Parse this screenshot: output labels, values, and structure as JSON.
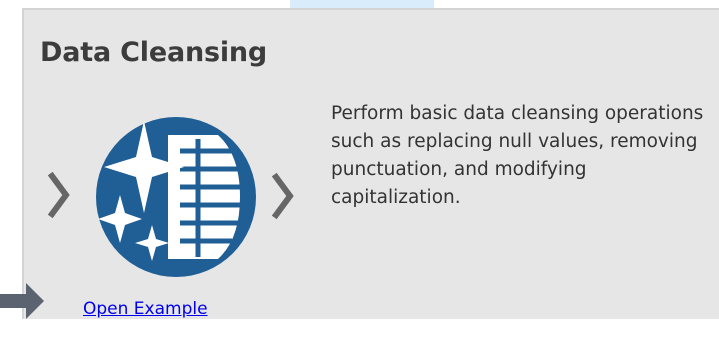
{
  "card": {
    "title": "Data Cleansing",
    "description": "Perform basic data cleansing operations such as replacing null values, removing punctuation, and modifying capitalization.",
    "link_label": "Open Example"
  },
  "icons": {
    "tool": "data-cleansing-icon",
    "left": "chevron-right-icon",
    "right": "chevron-right-icon",
    "pointer": "arrow-right-icon"
  },
  "colors": {
    "card_background": "#e6e6e6",
    "icon_circle": "#1f5f95",
    "link": "#0000ee",
    "chevron": "#666666",
    "pointer_arrow": "#5c6370",
    "tab_highlight": "#d9ecfb"
  }
}
